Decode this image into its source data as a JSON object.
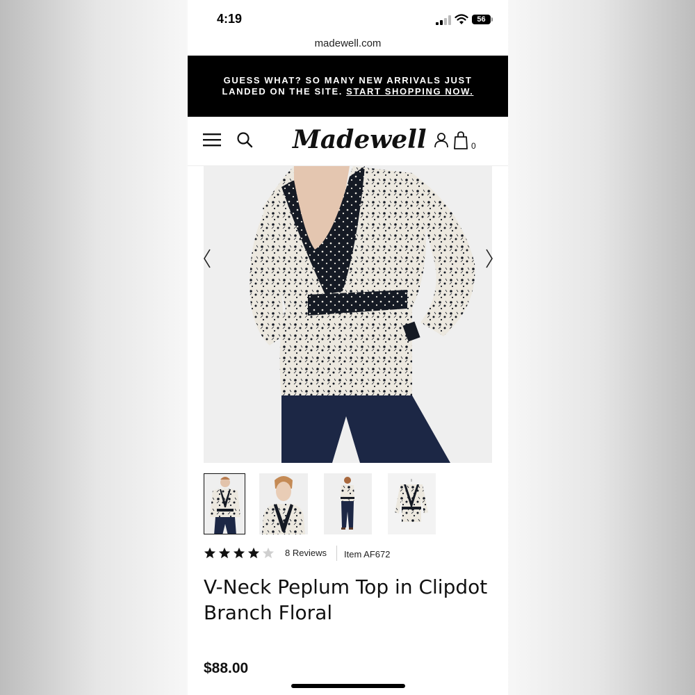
{
  "status_bar": {
    "time": "4:19",
    "battery": "56"
  },
  "browser": {
    "url": "madewell.com"
  },
  "promo": {
    "text": "GUESS WHAT? SO MANY NEW ARRIVALS JUST LANDED ON THE SITE.",
    "link": "START SHOPPING NOW."
  },
  "header": {
    "logo": "Madewell",
    "bag_count": "0"
  },
  "gallery": {
    "thumbnail_count": 4,
    "selected_index": 0,
    "colors": {
      "pattern_light": "#ece8df",
      "pattern_dark": "#151a24",
      "pants": "#1c2745"
    }
  },
  "product": {
    "rating": 4,
    "rating_max": 5,
    "reviews": "8 Reviews",
    "item": "Item AF672",
    "title": "V-Neck Peplum Top in Clipdot Branch Floral",
    "price": "$88.00"
  }
}
